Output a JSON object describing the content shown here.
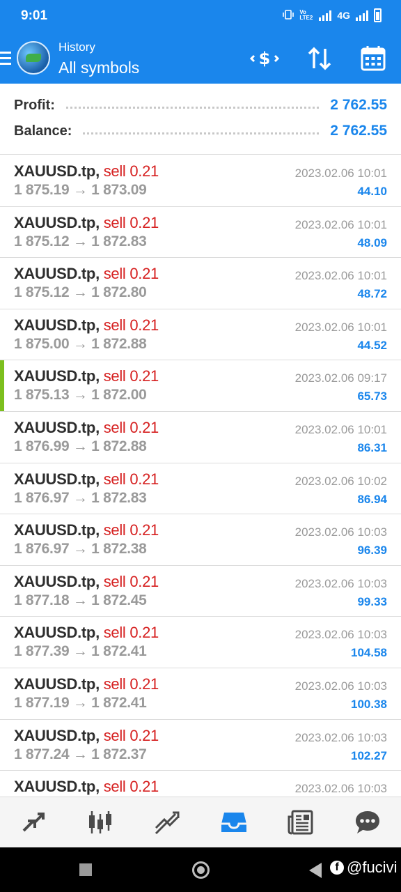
{
  "status_bar": {
    "time": "9:01",
    "network": "4G",
    "volte": "Vo LTE2"
  },
  "header": {
    "subtitle": "History",
    "title": "All symbols"
  },
  "summary": {
    "profit_label": "Profit:",
    "profit_value": "2 762.55",
    "balance_label": "Balance:",
    "balance_value": "2 762.55"
  },
  "deals": [
    {
      "symbol": "XAUUSD.tp,",
      "type": "sell 0.21",
      "open": "1 875.19",
      "close": "1 873.09",
      "time": "2023.02.06 10:01",
      "profit": "44.10"
    },
    {
      "symbol": "XAUUSD.tp,",
      "type": "sell 0.21",
      "open": "1 875.12",
      "close": "1 872.83",
      "time": "2023.02.06 10:01",
      "profit": "48.09"
    },
    {
      "symbol": "XAUUSD.tp,",
      "type": "sell 0.21",
      "open": "1 875.12",
      "close": "1 872.80",
      "time": "2023.02.06 10:01",
      "profit": "48.72"
    },
    {
      "symbol": "XAUUSD.tp,",
      "type": "sell 0.21",
      "open": "1 875.00",
      "close": "1 872.88",
      "time": "2023.02.06 10:01",
      "profit": "44.52"
    },
    {
      "symbol": "XAUUSD.tp,",
      "type": "sell 0.21",
      "open": "1 875.13",
      "close": "1 872.00",
      "time": "2023.02.06 09:17",
      "profit": "65.73",
      "marked": true
    },
    {
      "symbol": "XAUUSD.tp,",
      "type": "sell 0.21",
      "open": "1 876.99",
      "close": "1 872.88",
      "time": "2023.02.06 10:01",
      "profit": "86.31"
    },
    {
      "symbol": "XAUUSD.tp,",
      "type": "sell 0.21",
      "open": "1 876.97",
      "close": "1 872.83",
      "time": "2023.02.06 10:02",
      "profit": "86.94"
    },
    {
      "symbol": "XAUUSD.tp,",
      "type": "sell 0.21",
      "open": "1 876.97",
      "close": "1 872.38",
      "time": "2023.02.06 10:03",
      "profit": "96.39"
    },
    {
      "symbol": "XAUUSD.tp,",
      "type": "sell 0.21",
      "open": "1 877.18",
      "close": "1 872.45",
      "time": "2023.02.06 10:03",
      "profit": "99.33"
    },
    {
      "symbol": "XAUUSD.tp,",
      "type": "sell 0.21",
      "open": "1 877.39",
      "close": "1 872.41",
      "time": "2023.02.06 10:03",
      "profit": "104.58"
    },
    {
      "symbol": "XAUUSD.tp,",
      "type": "sell 0.21",
      "open": "1 877.19",
      "close": "1 872.41",
      "time": "2023.02.06 10:03",
      "profit": "100.38"
    },
    {
      "symbol": "XAUUSD.tp,",
      "type": "sell 0.21",
      "open": "1 877.24",
      "close": "1 872.37",
      "time": "2023.02.06 10:03",
      "profit": "102.27"
    },
    {
      "symbol": "XAUUSD.tp,",
      "type": "sell 0.21",
      "open": "",
      "close": "",
      "time": "2023.02.06 10:03",
      "profit": ""
    }
  ],
  "arrow_glyph": "→",
  "tabs": [
    {
      "icon": "quotes-icon"
    },
    {
      "icon": "chart-candles-icon"
    },
    {
      "icon": "trade-icon"
    },
    {
      "icon": "history-inbox-icon",
      "active": true
    },
    {
      "icon": "news-icon"
    },
    {
      "icon": "chat-icon"
    }
  ],
  "watermark": "@fucivi",
  "colors": {
    "brand_blue": "#1a86ec",
    "sell_red": "#d62020",
    "marker_green": "#7cbf1e",
    "tab_icon": "#4a4a4a"
  }
}
